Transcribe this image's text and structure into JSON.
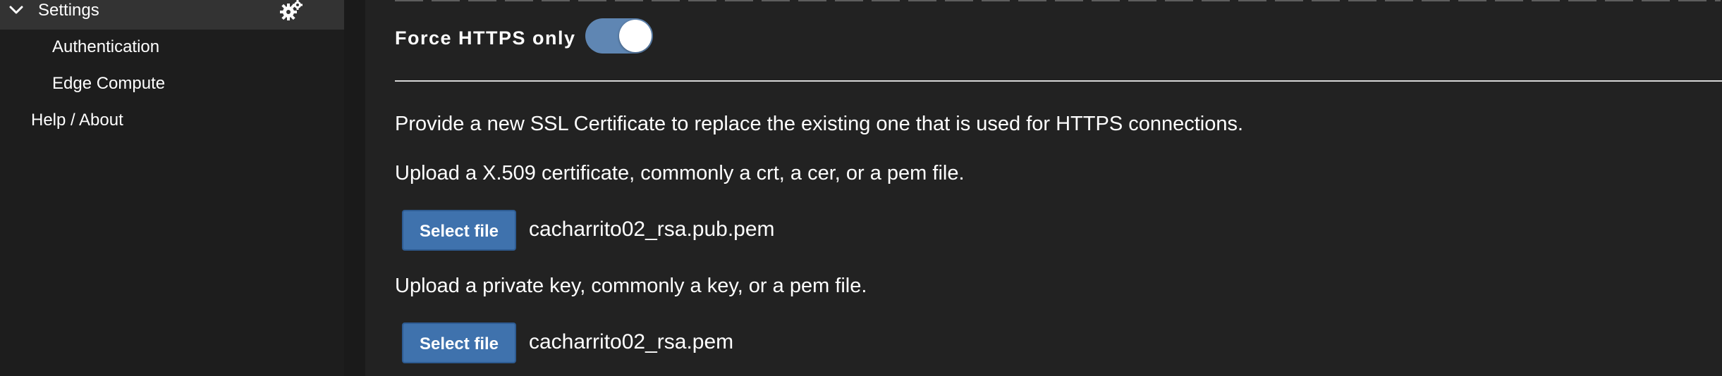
{
  "sidebar": {
    "section_label": "Settings",
    "items": [
      {
        "label": "Authentication"
      },
      {
        "label": "Edge Compute"
      }
    ],
    "help_label": "Help / About",
    "icons": {
      "chevron": "chevron-down-icon",
      "gear": "gears-icon"
    }
  },
  "main": {
    "force_https": {
      "label": "Force HTTPS only",
      "enabled": true
    },
    "ssl_intro": "Provide a new SSL Certificate to replace the existing one that is used for HTTPS connections.",
    "certificate": {
      "instruction": "Upload a X.509 certificate, commonly a crt, a cer, or a pem file.",
      "button_label": "Select file",
      "file_name": "cacharrito02_rsa.pub.pem"
    },
    "private_key": {
      "instruction": "Upload a private key, commonly a key, or a pem file.",
      "button_label": "Select file",
      "file_name": "cacharrito02_rsa.pem"
    }
  },
  "colors": {
    "background": "#222222",
    "sidebar_background": "#1d1d1d",
    "sidebar_header": "#333333",
    "accent_button": "#3f72ad",
    "toggle_on": "#5f86b3"
  }
}
